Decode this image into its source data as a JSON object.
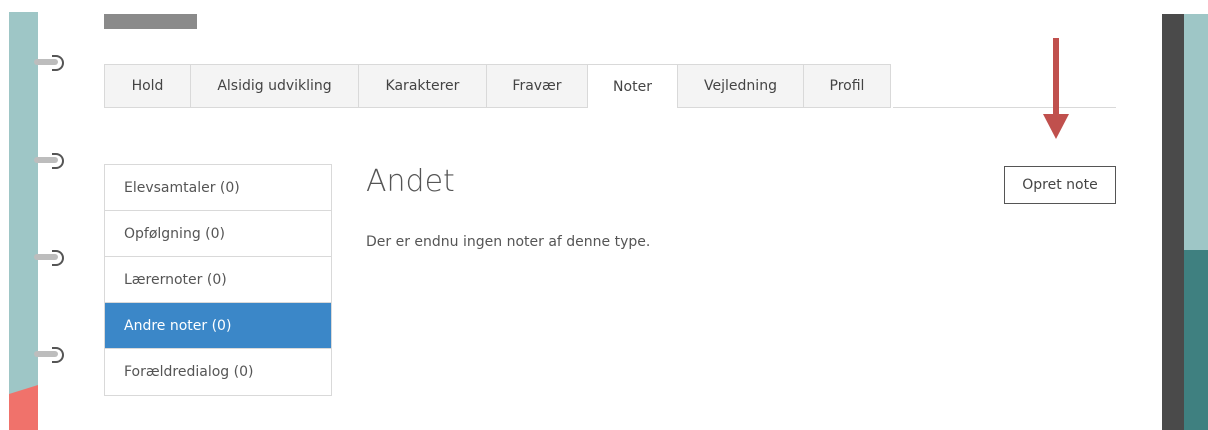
{
  "tabs": [
    {
      "label": "Hold",
      "width": 86
    },
    {
      "label": "Alsidig udvikling",
      "width": 168
    },
    {
      "label": "Karakterer",
      "width": 128
    },
    {
      "label": "Fravær",
      "width": 101
    },
    {
      "label": "Noter",
      "width": 90,
      "active": true
    },
    {
      "label": "Vejledning",
      "width": 126
    },
    {
      "label": "Profil",
      "width": 88
    }
  ],
  "side_menu": {
    "items": [
      {
        "label": "Elevsamtaler (0)"
      },
      {
        "label": "Opfølgning (0)"
      },
      {
        "label": "Lærernoter (0)"
      },
      {
        "label": "Andre noter (0)",
        "active": true
      },
      {
        "label": "Forældredialog (0)"
      }
    ]
  },
  "content": {
    "title": "Andet",
    "empty_text": "Der er endnu ingen noter af denne type."
  },
  "actions": {
    "create_note_label": "Opret note"
  },
  "colors": {
    "active_menu": "#3b87c8",
    "arrow": "#c0504d",
    "teal": "#9ec6c6"
  }
}
